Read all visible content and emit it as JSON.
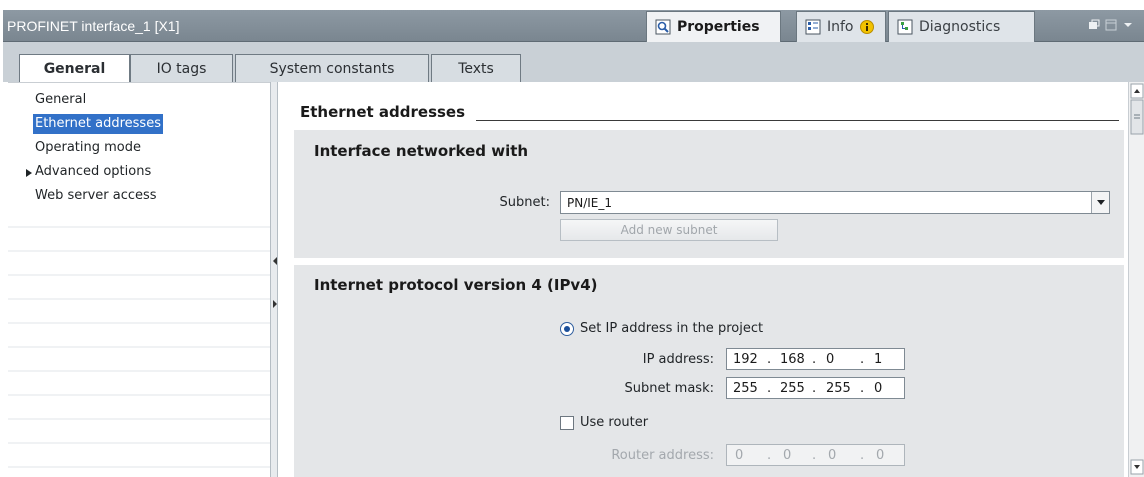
{
  "window": {
    "title": "PROFINET interface_1 [X1]",
    "inspector_tabs": [
      {
        "label": "Properties"
      },
      {
        "label": "Info"
      },
      {
        "label": "Diagnostics"
      }
    ]
  },
  "subtabs": [
    {
      "label": "General"
    },
    {
      "label": "IO tags"
    },
    {
      "label": "System constants"
    },
    {
      "label": "Texts"
    }
  ],
  "nav": {
    "items": [
      {
        "label": "General"
      },
      {
        "label": "Ethernet addresses"
      },
      {
        "label": "Operating mode"
      },
      {
        "label": "Advanced options"
      },
      {
        "label": "Web server access"
      }
    ],
    "selected": "Ethernet addresses"
  },
  "content": {
    "section_title": "Ethernet addresses",
    "interface_networked": {
      "title": "Interface networked with",
      "subnet_label": "Subnet:",
      "subnet_value": "PN/IE_1",
      "add_subnet_button": "Add new subnet"
    },
    "ipv4": {
      "title": "Internet protocol version 4 (IPv4)",
      "set_ip_label": "Set IP address in the project",
      "set_ip_selected": true,
      "ip_address_label": "IP address:",
      "ip_address": [
        "192",
        "168",
        "0",
        "1"
      ],
      "subnet_mask_label": "Subnet mask:",
      "subnet_mask": [
        "255",
        "255",
        "255",
        "0"
      ],
      "use_router_label": "Use router",
      "use_router_checked": false,
      "router_address_label": "Router address:",
      "router_address": [
        "0",
        "0",
        "0",
        "0"
      ]
    }
  },
  "colors": {
    "title_bar": "#7a8690",
    "selection": "#3271c8",
    "panel": "#e4e6e8"
  }
}
